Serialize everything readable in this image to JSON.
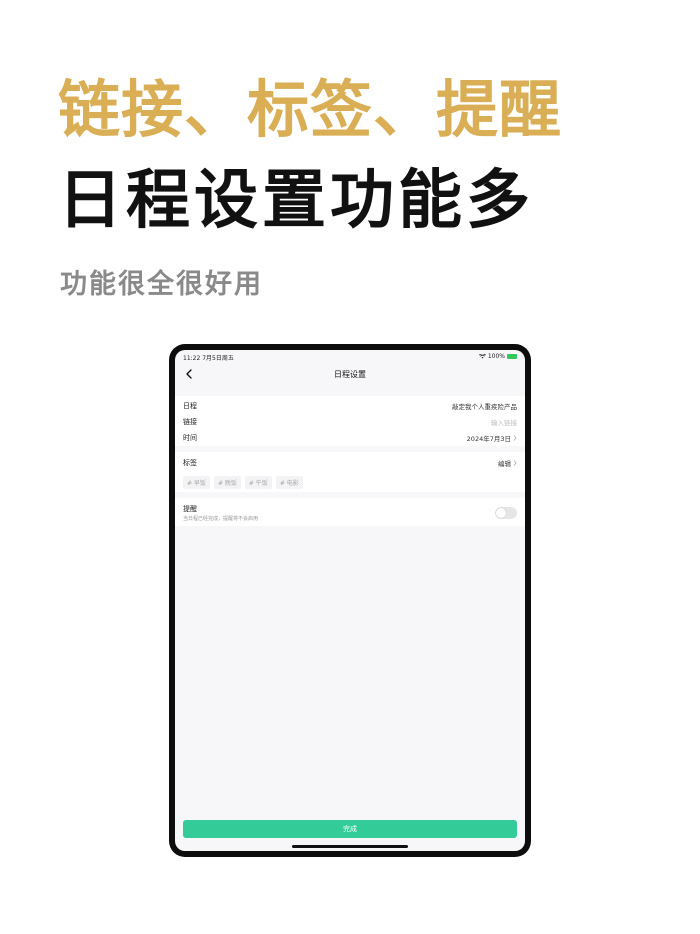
{
  "hero": {
    "title_line1": "链接、标签、提醒",
    "title_line2": "日程设置功能多",
    "subtitle": "功能很全很好用"
  },
  "status_bar": {
    "time_date": "11:22  7月5日周五",
    "battery_percent": "100%"
  },
  "navbar": {
    "title": "日程设置",
    "back_icon": "chevron-left-icon"
  },
  "form": {
    "schedule": {
      "label": "日程",
      "value": "敲定我个人重疾险产品"
    },
    "link": {
      "label": "链接",
      "placeholder": "输入链接"
    },
    "time": {
      "label": "时间",
      "value": "2024年7月3日"
    }
  },
  "tags": {
    "label": "标签",
    "edit_label": "编辑",
    "items": [
      "# 早饭",
      "# 晚饭",
      "# 午饭",
      "# 电影"
    ]
  },
  "reminder": {
    "label": "提醒",
    "hint": "当日程已经完成，提醒将不会启用",
    "enabled": false
  },
  "done_button": {
    "label": "完成"
  },
  "colors": {
    "accent_gold": "#D9AE55",
    "button_green": "#33CC99",
    "battery_green": "#34C759"
  }
}
